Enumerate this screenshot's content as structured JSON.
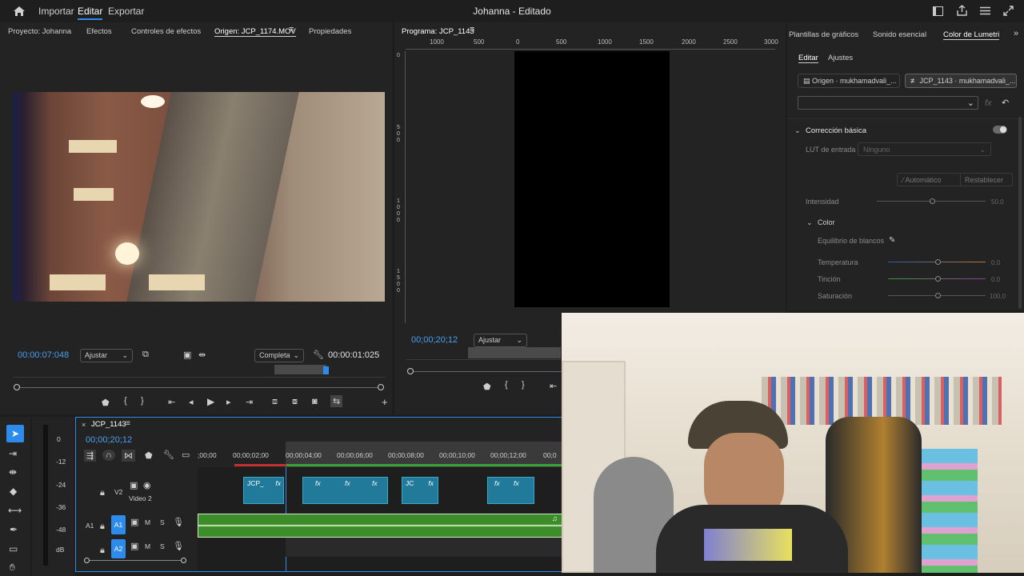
{
  "topbar": {
    "import": "Importar",
    "edit": "Editar",
    "export": "Exportar",
    "title": "Johanna - Editado"
  },
  "source": {
    "tabs": [
      "Proyecto: Johanna",
      "Efectos",
      "Controles de efectos",
      "Origen: JCP_1174.MOV",
      "Propiedades"
    ],
    "timecode": "00:00:07:048",
    "fit": "Ajustar",
    "quality": "Completa",
    "duration": "00:00:01:025"
  },
  "program": {
    "tab": "Programa: JCP_1143",
    "timecode": "00;00;20;12",
    "fit": "Ajustar",
    "ruler": [
      "1000",
      "500",
      "0",
      "500",
      "1000",
      "1500",
      "2000",
      "2500",
      "3000"
    ],
    "vruler": [
      "0",
      "5\n0\n0",
      "1\n0\n0\n0",
      "1\n5\n0\n0"
    ]
  },
  "lumetri": {
    "tabs": [
      "Plantillas de gráficos",
      "Sonido esencial",
      "Color de Lumetri"
    ],
    "subtabs": [
      "Editar",
      "Ajustes"
    ],
    "source_btn": "Origen · mukhamadvali_...",
    "seq_btn": "JCP_1143 · mukhamadvali_...",
    "basic": "Corrección básica",
    "lut_label": "LUT de entrada",
    "lut_value": "Ninguno",
    "auto": "Automático",
    "reset": "Restablecer",
    "intensity_label": "Intensidad",
    "intensity_value": "50.0",
    "color": "Color",
    "wb": "Equilibrio de blancos",
    "temp_label": "Temperatura",
    "temp_value": "0.0",
    "tint_label": "Tinción",
    "tint_value": "0.0",
    "sat_label": "Saturación",
    "sat_value": "100.0"
  },
  "timeline": {
    "tab": "JCP_1143",
    "timecode": "00;00;20;12",
    "ruler": [
      ";00;00",
      "00;00;02;00",
      "00;00;04;00",
      "00;00;06;00",
      "00;00;08;00",
      "00;00;10;00",
      "00;00;12;00",
      "00;0"
    ],
    "v2": "V2",
    "video2": "Video 2",
    "a1": "A1",
    "a1b": "A1",
    "a2": "A2",
    "m": "M",
    "s": "S",
    "clip1": "JCP_",
    "clip2": "JC"
  },
  "meter": [
    "0",
    "-12",
    "-24",
    "-36",
    "-48",
    "dB"
  ],
  "colors": {
    "accent": "#2d8ceb",
    "clip": "#217a99",
    "audio": "#3c8c2a"
  }
}
